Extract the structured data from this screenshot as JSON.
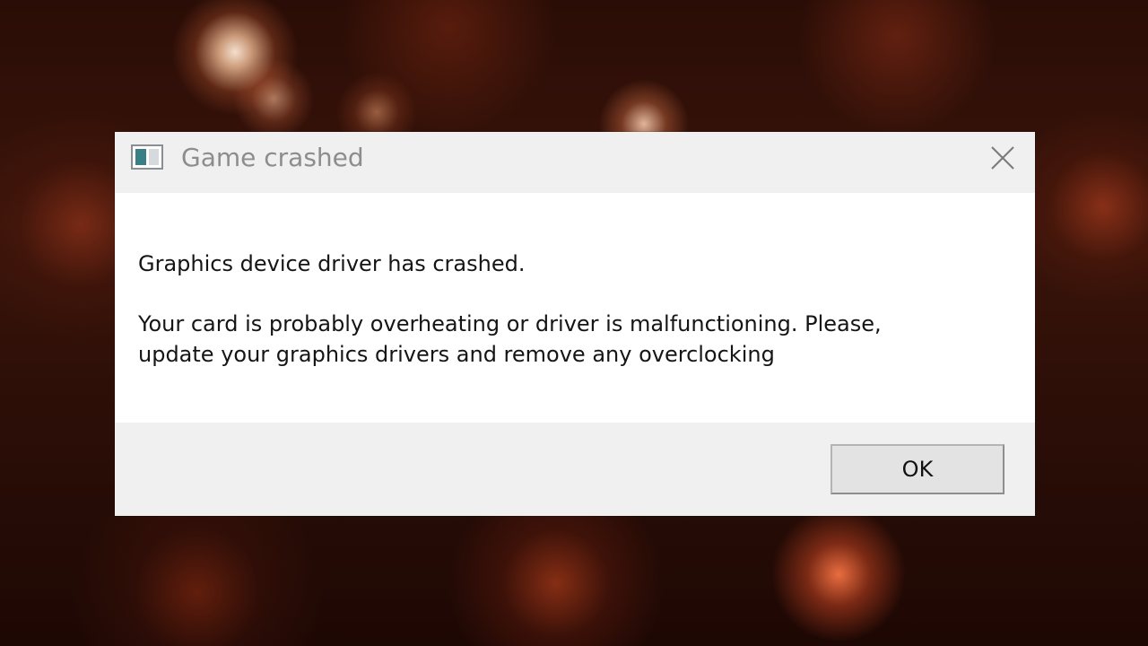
{
  "dialog": {
    "title": "Game crashed",
    "close_icon": "close-icon",
    "app_icon": "window-icon",
    "message": {
      "line1": "Graphics device driver has crashed.",
      "line2": "Your card is probably overheating or driver is malfunctioning. Please,",
      "line3": "update your graphics drivers and remove any overclocking"
    },
    "ok_label": "OK"
  },
  "colors": {
    "titlebar_bg": "#f0f0f0",
    "content_bg": "#ffffff",
    "title_text": "#8d8d8d",
    "body_text": "#151515",
    "icon_accent": "#3a7f86"
  }
}
